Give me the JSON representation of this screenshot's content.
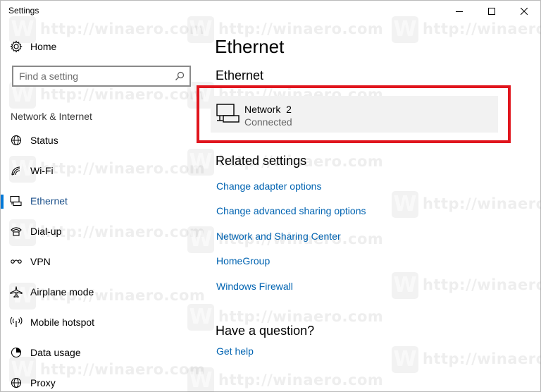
{
  "window": {
    "title": "Settings",
    "controls": {
      "minimize": "—",
      "maximize": "☐",
      "close": "✕"
    }
  },
  "sidebar": {
    "home": {
      "label": "Home",
      "icon": "gear-icon"
    },
    "search": {
      "placeholder": "Find a setting",
      "icon": "search-icon"
    },
    "section_title": "Network & Internet",
    "items": [
      {
        "label": "Status",
        "icon": "globe-icon",
        "active": false
      },
      {
        "label": "Wi-Fi",
        "icon": "wifi-icon",
        "active": false
      },
      {
        "label": "Ethernet",
        "icon": "ethernet-icon",
        "active": true
      },
      {
        "label": "Dial-up",
        "icon": "dialup-icon",
        "active": false
      },
      {
        "label": "VPN",
        "icon": "vpn-icon",
        "active": false
      },
      {
        "label": "Airplane mode",
        "icon": "airplane-icon",
        "active": false
      },
      {
        "label": "Mobile hotspot",
        "icon": "hotspot-icon",
        "active": false
      },
      {
        "label": "Data usage",
        "icon": "data-usage-icon",
        "active": false
      },
      {
        "label": "Proxy",
        "icon": "globe-icon",
        "active": false
      }
    ]
  },
  "main": {
    "page_title": "Ethernet",
    "section_title": "Ethernet",
    "network": {
      "name": "Network  2",
      "status": "Connected",
      "icon": "network-monitor-icon"
    },
    "related_title": "Related settings",
    "links": [
      "Change adapter options",
      "Change advanced sharing options",
      "Network and Sharing Center",
      "HomeGroup",
      "Windows Firewall"
    ],
    "question_title": "Have a question?",
    "help_link": "Get help"
  },
  "watermark": {
    "text": "http://winaero.com",
    "logo": "W"
  },
  "colors": {
    "accent": "#0078d7",
    "link": "#0063b1",
    "highlight_border": "#e0151d",
    "card_bg": "#f2f2f2"
  }
}
